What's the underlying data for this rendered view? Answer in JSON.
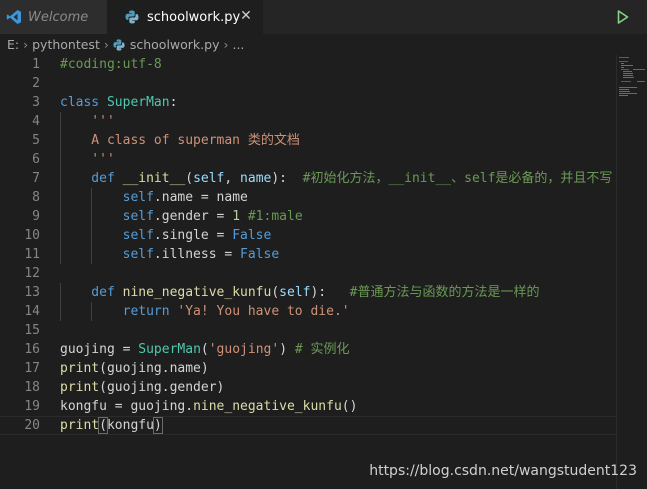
{
  "tabs": [
    {
      "label": "Welcome",
      "active": false
    },
    {
      "label": "schoolwork.py",
      "active": true
    }
  ],
  "breadcrumb": {
    "drive": "E:",
    "folder": "pythontest",
    "file": "schoolwork.py",
    "ellipsis": "..."
  },
  "line_numbers": [
    "1",
    "2",
    "3",
    "4",
    "5",
    "6",
    "7",
    "8",
    "9",
    "10",
    "11",
    "12",
    "13",
    "14",
    "15",
    "16",
    "17",
    "18",
    "19",
    "20"
  ],
  "code_lines": [
    [
      {
        "t": "#coding:utf-8",
        "c": "cmt"
      }
    ],
    [],
    [
      {
        "t": "class ",
        "c": "kw"
      },
      {
        "t": "SuperMan",
        "c": "cls"
      },
      {
        "t": ":",
        "c": "txt"
      }
    ],
    [
      {
        "t": "    '''",
        "c": "str"
      }
    ],
    [
      {
        "t": "    A class of superman 类的文档",
        "c": "str"
      }
    ],
    [
      {
        "t": "    '''",
        "c": "str"
      }
    ],
    [
      {
        "t": "    def ",
        "c": "kw"
      },
      {
        "t": "__init__",
        "c": "fn"
      },
      {
        "t": "(",
        "c": "txt"
      },
      {
        "t": "self",
        "c": "prm"
      },
      {
        "t": ", ",
        "c": "txt"
      },
      {
        "t": "name",
        "c": "prm"
      },
      {
        "t": "):  ",
        "c": "txt"
      },
      {
        "t": "#初始化方法，__init__、self是必备的，并且不写",
        "c": "cmt"
      }
    ],
    [
      {
        "t": "        self",
        "c": "slf"
      },
      {
        "t": ".name = name",
        "c": "txt"
      }
    ],
    [
      {
        "t": "        self",
        "c": "slf"
      },
      {
        "t": ".gender = ",
        "c": "txt"
      },
      {
        "t": "1",
        "c": "num"
      },
      {
        "t": " ",
        "c": "txt"
      },
      {
        "t": "#1:male",
        "c": "cmt"
      }
    ],
    [
      {
        "t": "        self",
        "c": "slf"
      },
      {
        "t": ".single = ",
        "c": "txt"
      },
      {
        "t": "False",
        "c": "kw"
      }
    ],
    [
      {
        "t": "        self",
        "c": "slf"
      },
      {
        "t": ".illness = ",
        "c": "txt"
      },
      {
        "t": "False",
        "c": "kw"
      }
    ],
    [],
    [
      {
        "t": "    def ",
        "c": "kw"
      },
      {
        "t": "nine_negative_kunfu",
        "c": "fn"
      },
      {
        "t": "(",
        "c": "txt"
      },
      {
        "t": "self",
        "c": "prm"
      },
      {
        "t": "):   ",
        "c": "txt"
      },
      {
        "t": "#普通方法与函数的方法是一样的",
        "c": "cmt"
      }
    ],
    [
      {
        "t": "        return ",
        "c": "kw"
      },
      {
        "t": "'Ya! You have to die.'",
        "c": "str"
      }
    ],
    [],
    [
      {
        "t": "guojing = ",
        "c": "txt"
      },
      {
        "t": "SuperMan",
        "c": "cls"
      },
      {
        "t": "(",
        "c": "txt"
      },
      {
        "t": "'guojing'",
        "c": "str"
      },
      {
        "t": ") ",
        "c": "txt"
      },
      {
        "t": "# 实例化",
        "c": "cmt"
      }
    ],
    [
      {
        "t": "print",
        "c": "fn"
      },
      {
        "t": "(guojing.name)",
        "c": "txt"
      }
    ],
    [
      {
        "t": "print",
        "c": "fn"
      },
      {
        "t": "(guojing.gender)",
        "c": "txt"
      }
    ],
    [
      {
        "t": "kongfu = guojing.",
        "c": "txt"
      },
      {
        "t": "nine_negative_kunfu",
        "c": "fn"
      },
      {
        "t": "()",
        "c": "txt"
      }
    ],
    [
      {
        "t": "print",
        "c": "fn"
      },
      {
        "t": "(",
        "c": "brk"
      },
      {
        "t": "kongfu",
        "c": "txt"
      },
      {
        "t": ")",
        "c": "brk"
      }
    ]
  ],
  "watermark": "https://blog.csdn.net/wangstudent123"
}
